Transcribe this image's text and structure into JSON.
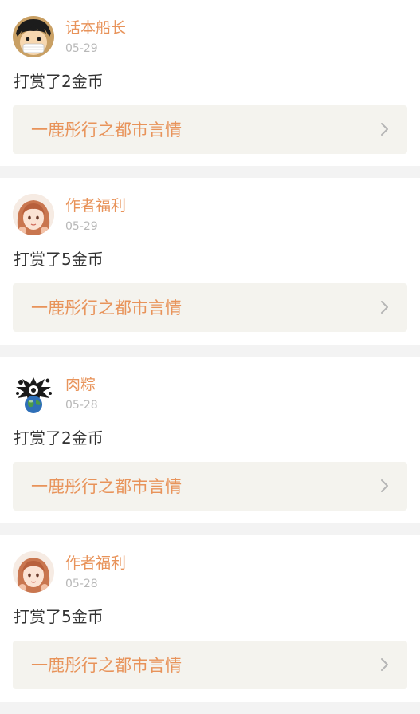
{
  "feed": {
    "items": [
      {
        "user_name": "话本船长",
        "date": "05-29",
        "reward_text": "打赏了2金币",
        "book_title": "一鹿彤行之都市言情",
        "avatar": "luffy-avatar-icon"
      },
      {
        "user_name": "作者福利",
        "date": "05-29",
        "reward_text": "打赏了5金币",
        "book_title": "一鹿彤行之都市言情",
        "avatar": "anime-girl-avatar-icon"
      },
      {
        "user_name": "肉粽",
        "date": "05-28",
        "reward_text": "打赏了2金币",
        "book_title": "一鹿彤行之都市言情",
        "avatar": "earth-splash-avatar-icon"
      },
      {
        "user_name": "作者福利",
        "date": "05-28",
        "reward_text": "打赏了5金币",
        "book_title": "一鹿彤行之都市言情",
        "avatar": "anime-girl-avatar-icon"
      }
    ]
  },
  "colors": {
    "accent": "#e8935a",
    "text": "#333333",
    "muted": "#b8b8b8",
    "link_bg": "#f4f3ee",
    "separator": "#f3f3f3",
    "tab_marker": "#f07aa8"
  },
  "icons": {
    "chevron": "chevron-right-icon"
  }
}
